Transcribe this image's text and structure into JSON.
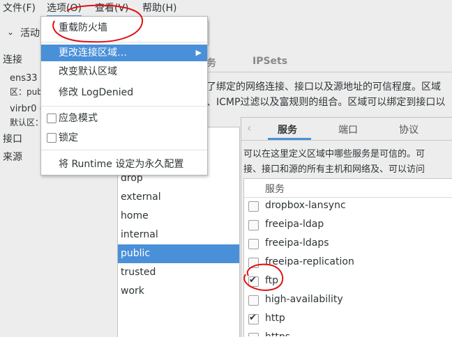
{
  "menubar": {
    "file": "文件(F)",
    "options": "选项(O)",
    "view": "查看(V)",
    "help": "帮助(H)"
  },
  "toolbar": {
    "activate_label": "活动"
  },
  "left": {
    "connections_label": "连接",
    "iface1": "ens33",
    "iface1_zone": "区：pub",
    "iface2": "virbr0 (",
    "iface2_zone": "默认区：",
    "ports_label": "接口",
    "sources_label": "来源"
  },
  "top_tabs": {
    "services_fragment": "务",
    "ipsets": "IPSets"
  },
  "zone_desc": {
    "line1": "了绑定的网络连接、接口以及源地址的可信程度。区域",
    "line2": "、ICMP过滤以及富规则的组合。区域可以绑定到接口以"
  },
  "zones": [
    {
      "name": "drop"
    },
    {
      "name": "external"
    },
    {
      "name": "home"
    },
    {
      "name": "internal"
    },
    {
      "name": "public",
      "selected": true
    },
    {
      "name": "trusted"
    },
    {
      "name": "work"
    }
  ],
  "subtabs": {
    "services": "服务",
    "ports": "端口",
    "protocols": "协议"
  },
  "services_desc": {
    "line1": "可以在这里定义区域中哪些服务是可信的。可",
    "line2": "接、接口和源的所有主机和网络及、可以访问"
  },
  "services_table": {
    "header": "服务",
    "rows": [
      {
        "name": "dropbox-lansync",
        "checked": false
      },
      {
        "name": "freeipa-ldap",
        "checked": false
      },
      {
        "name": "freeipa-ldaps",
        "checked": false
      },
      {
        "name": "freeipa-replication",
        "checked": false
      },
      {
        "name": "ftp",
        "checked": true
      },
      {
        "name": "high-availability",
        "checked": false
      },
      {
        "name": "http",
        "checked": true
      },
      {
        "name": "https",
        "checked": false
      }
    ]
  },
  "dropdown": {
    "reload": "重载防火墙",
    "change_zone": "更改连接区域…",
    "change_default": "改变默认区域",
    "log_denied": "修改  LogDenied",
    "panic_mode": "应急模式",
    "lockdown": "锁定",
    "runtime_to_permanent": "将  Runtime 设定为永久配置"
  },
  "colors": {
    "accent": "#4a90d9",
    "annotation": "#e01010"
  }
}
